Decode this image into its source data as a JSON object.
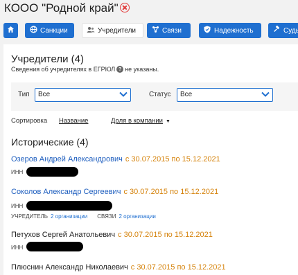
{
  "header": {
    "company_name": "КООО \"Родной край\""
  },
  "tabs": [
    {
      "label": "",
      "icon": "home-icon"
    },
    {
      "label": "Санкции",
      "icon": "globe-icon"
    },
    {
      "label": "Учредители",
      "icon": "users-icon"
    },
    {
      "label": "Связи",
      "icon": "network-icon"
    },
    {
      "label": "Надежность",
      "icon": "shield-icon"
    },
    {
      "label": "Суды",
      "icon": "gavel-icon"
    }
  ],
  "founders": {
    "title": "Учредители (4)",
    "note_before": "Сведения об учредителях в ЕГРЮЛ",
    "note_after": "не указаны."
  },
  "filters": {
    "type_label": "Тип",
    "type_value": "Все",
    "status_label": "Статус",
    "status_value": "Все"
  },
  "sort": {
    "label": "Сортировка",
    "by_name": "Название",
    "by_share": "Доля в компании"
  },
  "historical": {
    "title": "Исторические (4)",
    "people": [
      {
        "name": "Озеров Андрей Александрович",
        "dates": "с 30.07.2015 по 15.12.2021",
        "inn_label": "ИНН"
      },
      {
        "name": "Соколов Александр Сергеевич",
        "dates": "с 30.07.2015 по 15.12.2021",
        "inn_label": "ИНН",
        "founder_label": "УЧРЕДИТЕЛЬ",
        "founder_value": "2 организации",
        "links_label": "СВЯЗИ",
        "links_value": "2 организации"
      },
      {
        "name": "Петухов Сергей Анатольевич",
        "dates": "с 30.07.2015 по 15.12.2021",
        "inn_label": "ИНН"
      },
      {
        "name": "Плюснин Александр Николаевич",
        "dates": "с 30.07.2015 по 15.12.2021"
      }
    ]
  },
  "colors": {
    "accent": "#1f6fd0",
    "dates": "#d5820a",
    "close": "#e23b3b"
  }
}
